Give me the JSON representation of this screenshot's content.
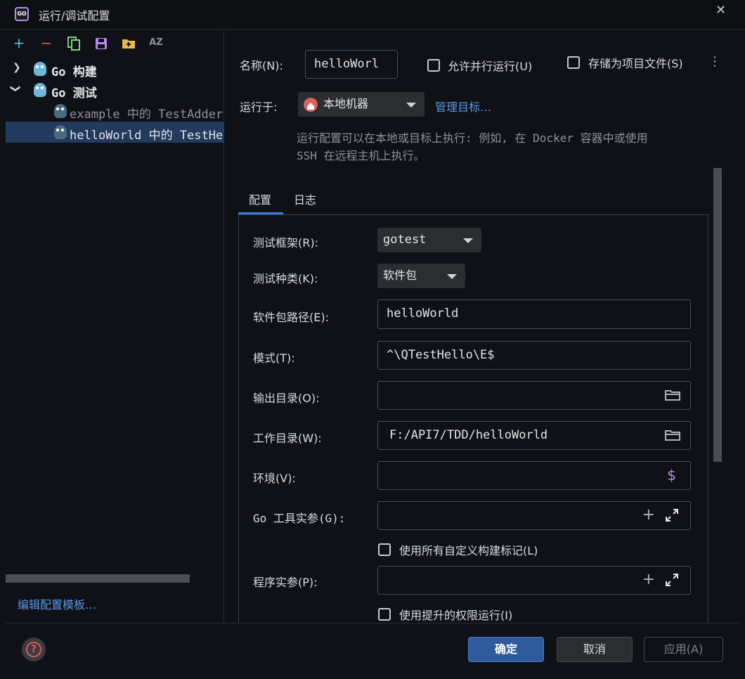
{
  "window": {
    "title": "运行/调试配置",
    "app_icon_text": "GO",
    "close_glyph": "✕"
  },
  "left": {
    "toolbar": {
      "add": "+",
      "remove": "−",
      "sort": "AZ"
    },
    "tree": [
      {
        "label": "Go 构建",
        "expanded": false
      },
      {
        "label": "Go 测试",
        "expanded": true
      },
      {
        "label": "example 中的 TestAdder"
      },
      {
        "label": "helloWorld 中的 TestHello"
      }
    ],
    "edit_templates": "编辑配置模板…"
  },
  "top": {
    "name_label": "名称(N):",
    "name_value": "helloWorl",
    "allow_parallel": "允许并行运行(U)",
    "store_as_file": "存储为项目文件(S)",
    "run_on_label": "运行于:",
    "run_on_value": "本地机器",
    "manage_targets": "管理目标…",
    "desc_line1": "运行配置可以在本地或目标上执行: 例如, 在 Docker 容器中或使用",
    "desc_line2": "SSH 在远程主机上执行。"
  },
  "tabs": [
    "配置",
    "日志"
  ],
  "form": {
    "framework_label": "测试框架(R):",
    "framework_value": "gotest",
    "kind_label": "测试种类(K):",
    "kind_value": "软件包",
    "package_label": "软件包路径(E):",
    "package_value": "helloWorld",
    "pattern_label": "模式(T):",
    "pattern_value": "^\\QTestHello\\E$",
    "output_label": "输出目录(O):",
    "output_value": "",
    "workdir_label": "工作目录(W):",
    "workdir_value": "F:/API7/TDD/helloWorld",
    "env_label": "环境(V):",
    "env_value": "",
    "env_icon": "$",
    "gotool_label": "Go 工具实参(G):",
    "gotool_value": "",
    "use_tags": "使用所有自定义构建标记(L)",
    "program_label": "程序实参(P):",
    "program_value": "",
    "elevated": "使用提升的权限运行(I)"
  },
  "buttons": {
    "ok": "确定",
    "cancel": "取消",
    "apply": "应用(A)",
    "help": "?"
  },
  "colors": {
    "accent": "#3d7bd4",
    "link": "#5a9ae6",
    "selected_row": "#223a5e"
  }
}
